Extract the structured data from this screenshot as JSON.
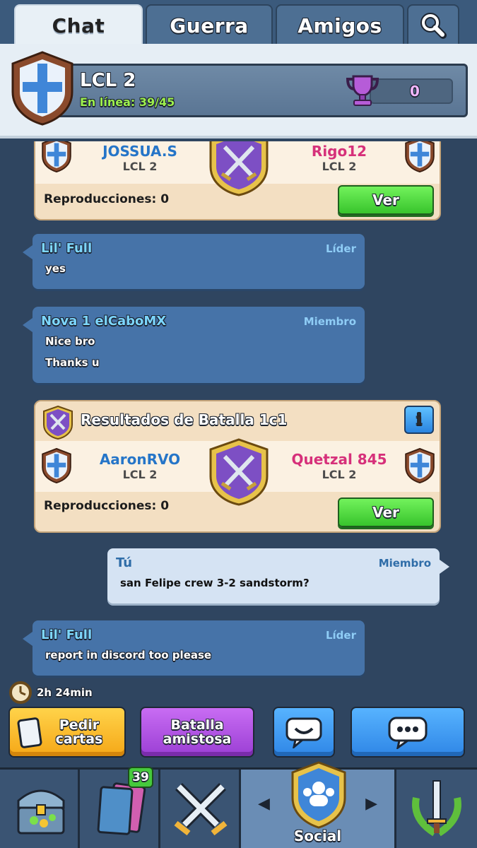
{
  "tabs": [
    {
      "label": "Chat",
      "active": true
    },
    {
      "label": "Guerra",
      "active": false
    },
    {
      "label": "Amigos",
      "active": false
    }
  ],
  "search_icon": "magnifier-icon",
  "clan": {
    "name": "LCL 2",
    "online": "En línea: 39/45",
    "trophies": "0",
    "badge_icon": "shield-cross-badge-icon",
    "trophy_icon": "purple-trophy-icon"
  },
  "feed": {
    "battle1": {
      "player_left": "JOSSUA.S",
      "clan_left": "LCL 2",
      "player_right": "Rigo12",
      "clan_right": "LCL 2",
      "replays": "Reproducciones:  0",
      "button": "Ver"
    },
    "msg1": {
      "author": "Lil' Full",
      "role": "Líder",
      "lines": [
        "yes"
      ]
    },
    "msg2": {
      "author": "Nova 1 elCaboMX",
      "role": "Miembro",
      "lines": [
        "Nice bro",
        "Thanks u"
      ]
    },
    "battle2": {
      "title": "Resultados de Batalla 1c1",
      "player_left": "AaronRVO",
      "clan_left": "LCL 2",
      "player_right": "Quetzal 845",
      "clan_right": "LCL 2",
      "replays": "Reproducciones:  0",
      "button": "Ver",
      "info": "i"
    },
    "msg3": {
      "author": "Tú",
      "role": "Miembro",
      "lines": [
        "san Felipe crew 3-2 sandstorm?"
      ]
    },
    "msg4": {
      "author": "Lil' Full",
      "role": "Líder",
      "lines": [
        "report in discord too please"
      ]
    }
  },
  "timer": "2h 24min",
  "actions": {
    "request": "Pedir cartas",
    "friendly": "Batalla amistosa"
  },
  "bottom_nav": {
    "cards_badge": "39",
    "social_label": "Social"
  },
  "colors": {
    "chat_bg": "#2f4560",
    "message_bg": "#4673a8",
    "own_message_bg": "#d5e3f3",
    "battle_card_bg": "#f3dfc2",
    "ver_button": "#38c42c",
    "request_button": "#f5a717",
    "friendly_button": "#9b3fd4",
    "chat_button": "#2f86e6"
  }
}
